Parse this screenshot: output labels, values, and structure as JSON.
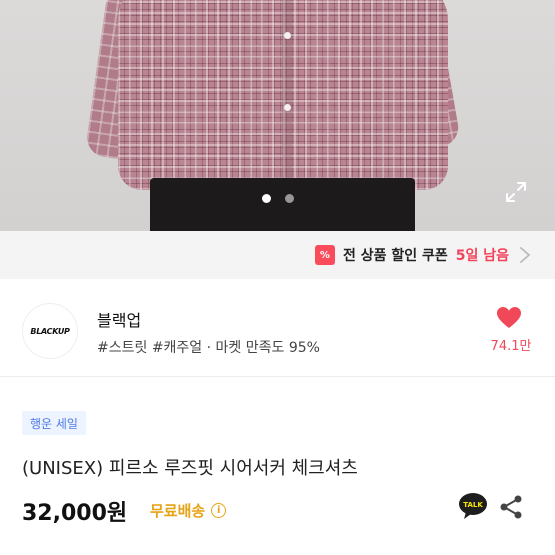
{
  "gallery": {
    "image_count": 2,
    "current_index": 1,
    "expand_icon": "expand-icon"
  },
  "coupon": {
    "icon": "coupon-icon",
    "label": "전 상품 할인 쿠폰",
    "remaining": "5일 남음"
  },
  "shop": {
    "logo_text": "BLACKUP",
    "name": "블랙업",
    "tags": "#스트릿 #캐주얼 · 마켓 만족도 95%",
    "likes": "74.1만",
    "heart_color": "#f04858"
  },
  "product": {
    "badge": "행운 세일",
    "title": "(UNISEX) 피르소 루즈핏 시어서커 체크셔츠",
    "price": "32,000원",
    "shipping": "무료배송",
    "talk_label": "TALK"
  },
  "colors": {
    "accent_red": "#f3425a",
    "shipping_gold": "#e6a316",
    "badge_blue": "#4e7be6"
  }
}
